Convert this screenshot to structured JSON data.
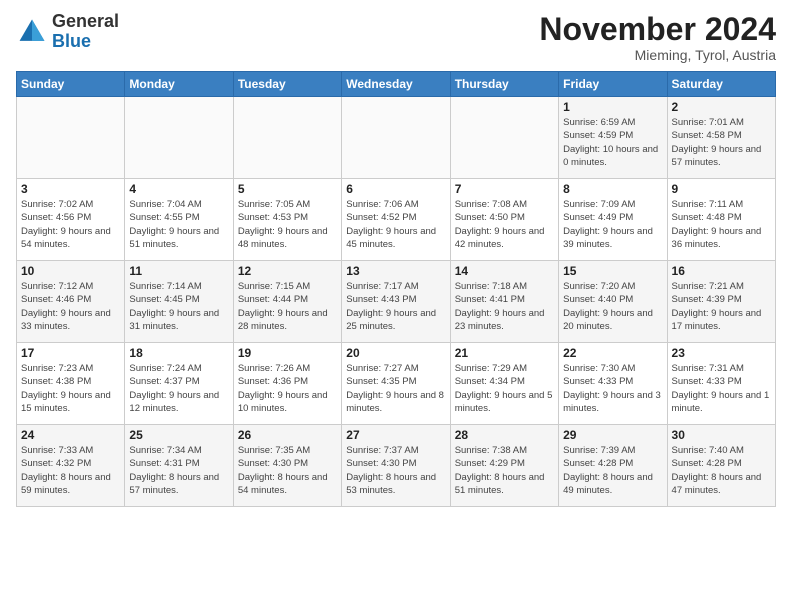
{
  "logo": {
    "general": "General",
    "blue": "Blue"
  },
  "header": {
    "month_title": "November 2024",
    "location": "Mieming, Tyrol, Austria"
  },
  "weekdays": [
    "Sunday",
    "Monday",
    "Tuesday",
    "Wednesday",
    "Thursday",
    "Friday",
    "Saturday"
  ],
  "weeks": [
    [
      {
        "day": "",
        "sunrise": "",
        "sunset": "",
        "daylight": ""
      },
      {
        "day": "",
        "sunrise": "",
        "sunset": "",
        "daylight": ""
      },
      {
        "day": "",
        "sunrise": "",
        "sunset": "",
        "daylight": ""
      },
      {
        "day": "",
        "sunrise": "",
        "sunset": "",
        "daylight": ""
      },
      {
        "day": "",
        "sunrise": "",
        "sunset": "",
        "daylight": ""
      },
      {
        "day": "1",
        "sunrise": "Sunrise: 6:59 AM",
        "sunset": "Sunset: 4:59 PM",
        "daylight": "Daylight: 10 hours and 0 minutes."
      },
      {
        "day": "2",
        "sunrise": "Sunrise: 7:01 AM",
        "sunset": "Sunset: 4:58 PM",
        "daylight": "Daylight: 9 hours and 57 minutes."
      }
    ],
    [
      {
        "day": "3",
        "sunrise": "Sunrise: 7:02 AM",
        "sunset": "Sunset: 4:56 PM",
        "daylight": "Daylight: 9 hours and 54 minutes."
      },
      {
        "day": "4",
        "sunrise": "Sunrise: 7:04 AM",
        "sunset": "Sunset: 4:55 PM",
        "daylight": "Daylight: 9 hours and 51 minutes."
      },
      {
        "day": "5",
        "sunrise": "Sunrise: 7:05 AM",
        "sunset": "Sunset: 4:53 PM",
        "daylight": "Daylight: 9 hours and 48 minutes."
      },
      {
        "day": "6",
        "sunrise": "Sunrise: 7:06 AM",
        "sunset": "Sunset: 4:52 PM",
        "daylight": "Daylight: 9 hours and 45 minutes."
      },
      {
        "day": "7",
        "sunrise": "Sunrise: 7:08 AM",
        "sunset": "Sunset: 4:50 PM",
        "daylight": "Daylight: 9 hours and 42 minutes."
      },
      {
        "day": "8",
        "sunrise": "Sunrise: 7:09 AM",
        "sunset": "Sunset: 4:49 PM",
        "daylight": "Daylight: 9 hours and 39 minutes."
      },
      {
        "day": "9",
        "sunrise": "Sunrise: 7:11 AM",
        "sunset": "Sunset: 4:48 PM",
        "daylight": "Daylight: 9 hours and 36 minutes."
      }
    ],
    [
      {
        "day": "10",
        "sunrise": "Sunrise: 7:12 AM",
        "sunset": "Sunset: 4:46 PM",
        "daylight": "Daylight: 9 hours and 33 minutes."
      },
      {
        "day": "11",
        "sunrise": "Sunrise: 7:14 AM",
        "sunset": "Sunset: 4:45 PM",
        "daylight": "Daylight: 9 hours and 31 minutes."
      },
      {
        "day": "12",
        "sunrise": "Sunrise: 7:15 AM",
        "sunset": "Sunset: 4:44 PM",
        "daylight": "Daylight: 9 hours and 28 minutes."
      },
      {
        "day": "13",
        "sunrise": "Sunrise: 7:17 AM",
        "sunset": "Sunset: 4:43 PM",
        "daylight": "Daylight: 9 hours and 25 minutes."
      },
      {
        "day": "14",
        "sunrise": "Sunrise: 7:18 AM",
        "sunset": "Sunset: 4:41 PM",
        "daylight": "Daylight: 9 hours and 23 minutes."
      },
      {
        "day": "15",
        "sunrise": "Sunrise: 7:20 AM",
        "sunset": "Sunset: 4:40 PM",
        "daylight": "Daylight: 9 hours and 20 minutes."
      },
      {
        "day": "16",
        "sunrise": "Sunrise: 7:21 AM",
        "sunset": "Sunset: 4:39 PM",
        "daylight": "Daylight: 9 hours and 17 minutes."
      }
    ],
    [
      {
        "day": "17",
        "sunrise": "Sunrise: 7:23 AM",
        "sunset": "Sunset: 4:38 PM",
        "daylight": "Daylight: 9 hours and 15 minutes."
      },
      {
        "day": "18",
        "sunrise": "Sunrise: 7:24 AM",
        "sunset": "Sunset: 4:37 PM",
        "daylight": "Daylight: 9 hours and 12 minutes."
      },
      {
        "day": "19",
        "sunrise": "Sunrise: 7:26 AM",
        "sunset": "Sunset: 4:36 PM",
        "daylight": "Daylight: 9 hours and 10 minutes."
      },
      {
        "day": "20",
        "sunrise": "Sunrise: 7:27 AM",
        "sunset": "Sunset: 4:35 PM",
        "daylight": "Daylight: 9 hours and 8 minutes."
      },
      {
        "day": "21",
        "sunrise": "Sunrise: 7:29 AM",
        "sunset": "Sunset: 4:34 PM",
        "daylight": "Daylight: 9 hours and 5 minutes."
      },
      {
        "day": "22",
        "sunrise": "Sunrise: 7:30 AM",
        "sunset": "Sunset: 4:33 PM",
        "daylight": "Daylight: 9 hours and 3 minutes."
      },
      {
        "day": "23",
        "sunrise": "Sunrise: 7:31 AM",
        "sunset": "Sunset: 4:33 PM",
        "daylight": "Daylight: 9 hours and 1 minute."
      }
    ],
    [
      {
        "day": "24",
        "sunrise": "Sunrise: 7:33 AM",
        "sunset": "Sunset: 4:32 PM",
        "daylight": "Daylight: 8 hours and 59 minutes."
      },
      {
        "day": "25",
        "sunrise": "Sunrise: 7:34 AM",
        "sunset": "Sunset: 4:31 PM",
        "daylight": "Daylight: 8 hours and 57 minutes."
      },
      {
        "day": "26",
        "sunrise": "Sunrise: 7:35 AM",
        "sunset": "Sunset: 4:30 PM",
        "daylight": "Daylight: 8 hours and 54 minutes."
      },
      {
        "day": "27",
        "sunrise": "Sunrise: 7:37 AM",
        "sunset": "Sunset: 4:30 PM",
        "daylight": "Daylight: 8 hours and 53 minutes."
      },
      {
        "day": "28",
        "sunrise": "Sunrise: 7:38 AM",
        "sunset": "Sunset: 4:29 PM",
        "daylight": "Daylight: 8 hours and 51 minutes."
      },
      {
        "day": "29",
        "sunrise": "Sunrise: 7:39 AM",
        "sunset": "Sunset: 4:28 PM",
        "daylight": "Daylight: 8 hours and 49 minutes."
      },
      {
        "day": "30",
        "sunrise": "Sunrise: 7:40 AM",
        "sunset": "Sunset: 4:28 PM",
        "daylight": "Daylight: 8 hours and 47 minutes."
      }
    ]
  ]
}
